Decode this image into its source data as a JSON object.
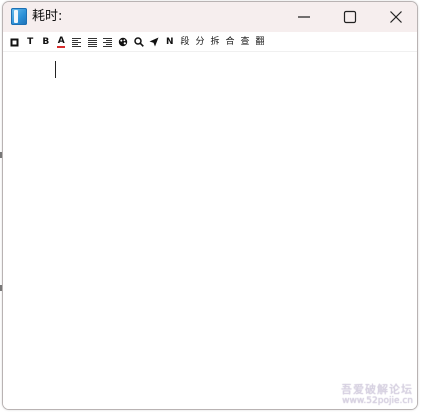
{
  "window": {
    "title": "耗时:",
    "app_icon": "book-icon",
    "controls": {
      "minimize_icon": "minimize-icon",
      "maximize_icon": "maximize-icon",
      "close_icon": "close-icon"
    }
  },
  "toolbar": {
    "items": [
      {
        "name": "pin-tool-button",
        "glyph": "⊡",
        "icon": "square-icon"
      },
      {
        "name": "font-tool-button",
        "glyph": "T",
        "icon": "text-icon"
      },
      {
        "name": "bold-tool-button",
        "glyph": "B",
        "icon": "bold-icon"
      },
      {
        "name": "font-color-tool-button",
        "glyph": "A",
        "icon": "font-color-icon"
      },
      {
        "name": "align-left-tool-button",
        "glyph": "≣",
        "icon": "align-left-icon"
      },
      {
        "name": "align-justify-tool-button",
        "glyph": "☰",
        "icon": "align-justify-icon"
      },
      {
        "name": "align-right-tool-button",
        "glyph": "≣",
        "icon": "align-right-icon"
      },
      {
        "name": "theme-tool-button",
        "glyph": "◐",
        "icon": "palette-icon"
      },
      {
        "name": "search-tool-button",
        "glyph": "⚲",
        "icon": "search-icon"
      },
      {
        "name": "send-tool-button",
        "glyph": "➤",
        "icon": "send-icon"
      },
      {
        "name": "n-tool-button",
        "glyph": "N",
        "icon": "n-icon"
      },
      {
        "name": "segment-tool-button",
        "glyph": "段"
      },
      {
        "name": "split-tool-button",
        "glyph": "分"
      },
      {
        "name": "break-tool-button",
        "glyph": "拆"
      },
      {
        "name": "merge-tool-button",
        "glyph": "合"
      },
      {
        "name": "check-tool-button",
        "glyph": "查"
      },
      {
        "name": "translate-tool-button",
        "glyph": "翻"
      }
    ]
  },
  "editor": {
    "content": ""
  },
  "watermark": {
    "line1": "吾爱破解论坛",
    "line2": "www.52pojie.cn"
  },
  "colors": {
    "titlebar_bg": "#f6eeee",
    "font_color_underline": "#d62c2c",
    "window_border": "#b9b3b3"
  }
}
